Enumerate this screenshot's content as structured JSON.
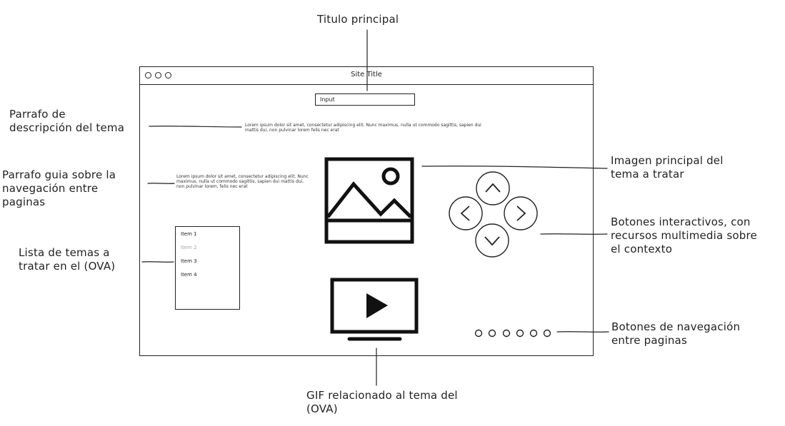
{
  "annotations": {
    "main_title": "Titulo principal",
    "desc_paragraph": "Parrafo de\ndescripción del tema",
    "guide_paragraph": "Parrafo guia sobre la\nnavegación entre\npaginas",
    "topic_list": "Lista de temas a\ntratar en el (OVA)",
    "main_image": "Imagen principal del\ntema a tratar",
    "interactive_buttons": "Botones interactivos, con\nrecursos multimedia sobre\nel contexto",
    "nav_buttons": "Botones de navegación\nentre paginas",
    "gif": "GIF relacionado al tema del\n(OVA)"
  },
  "window": {
    "site_title": "Site Title",
    "input_label": "Input",
    "description_text": "Lorem ipsum dolor sit amet, consectetur adipiscing elit. Nunc maximus, nulla ut commodo sagittis, sapien dui mattis dui, non pulvinar lorem felis nec erat",
    "guide_text": "Lorem ipsum dolor sit amet, consectetur adipiscing elit. Nunc maximus, nulla ut commodo sagittis, sapien dui mattis dui, non pulvinar lorem, felis nec erat",
    "list_items": [
      "Item 1",
      "Item 2",
      "Item 3",
      "Item 4"
    ],
    "pagination_count": 6
  },
  "icons": {
    "image": "image-placeholder-icon",
    "video": "video-play-icon",
    "up": "arrow-up-icon",
    "down": "arrow-down-icon",
    "left": "arrow-left-icon",
    "right": "arrow-right-icon"
  }
}
